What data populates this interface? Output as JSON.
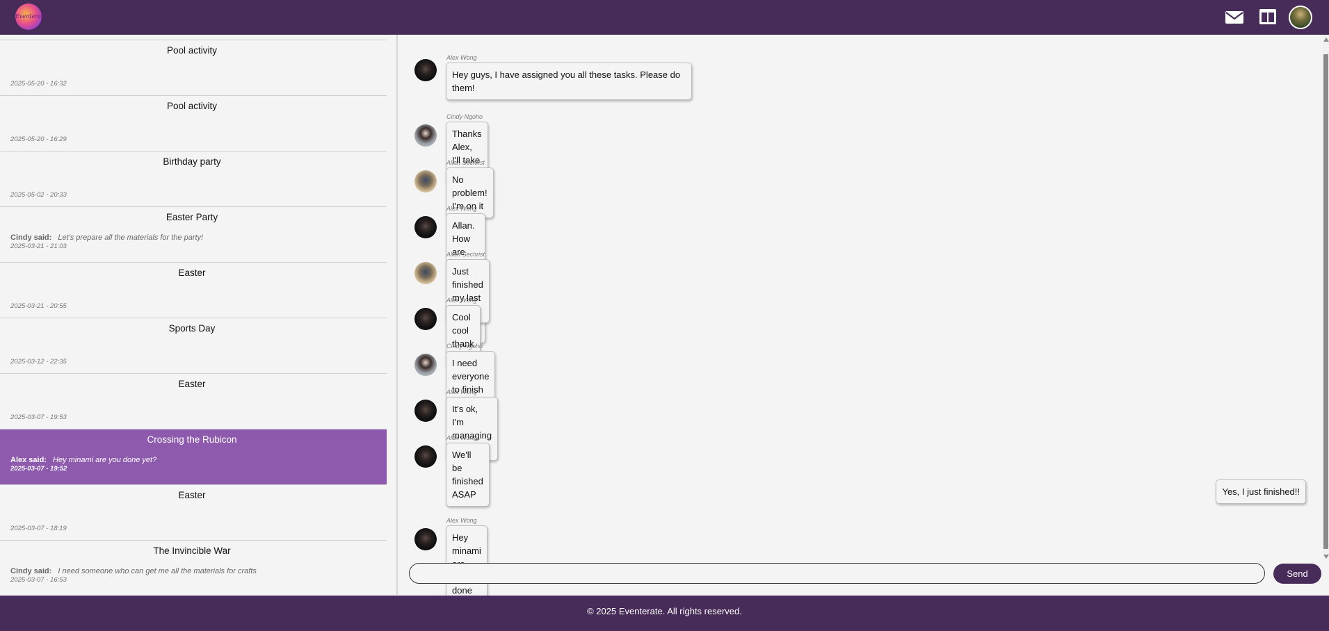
{
  "app": {
    "logo_text": "Eventerate",
    "icons": [
      "mail-icon",
      "layout-icon"
    ],
    "accent_color": "#472b58",
    "active_color": "#8e5aae"
  },
  "sidebar": {
    "chats": [
      {
        "title": "Pool activity",
        "sender": "",
        "message": "",
        "time": "2025-05-20 - 16:32"
      },
      {
        "title": "Pool activity",
        "sender": "",
        "message": "",
        "time": "2025-05-20 - 16:29"
      },
      {
        "title": "Birthday party",
        "sender": "",
        "message": "",
        "time": "2025-05-02 - 20:33"
      },
      {
        "title": "Easter Party",
        "sender": "Cindy said:",
        "message": "Let's prepare all the materials for the party!",
        "time": "2025-03-21 - 21:03"
      },
      {
        "title": "Easter",
        "sender": "",
        "message": "",
        "time": "2025-03-21 - 20:55"
      },
      {
        "title": "Sports Day",
        "sender": "",
        "message": "",
        "time": "2025-03-12 - 22:35"
      },
      {
        "title": "Easter",
        "sender": "",
        "message": "",
        "time": "2025-03-07 - 19:53"
      },
      {
        "title": "Crossing the Rubicon",
        "sender": "Alex said:",
        "message": "Hey minami are you done yet?",
        "time": "2025-03-07 - 19:52"
      },
      {
        "title": "Easter",
        "sender": "",
        "message": "",
        "time": "2025-03-07 - 18:19"
      },
      {
        "title": "The Invincible War",
        "sender": "Cindy said:",
        "message": "I need someone who can get me all the materials for crafts",
        "time": "2025-03-07 - 16:53"
      }
    ]
  },
  "conversation": {
    "messages": [
      {
        "sender": "Alex Wong",
        "text": "Hey guys, I have assigned you all these tasks. Please do them!"
      },
      {
        "sender": "Cindy Ngoho",
        "text": "Thanks Alex, I'll take a look."
      },
      {
        "sender": "Allan Sechrist",
        "text": "No problem! I'm on it"
      },
      {
        "sender": "Alex Wong",
        "text": "Allan. How are you getting on with the tasks?"
      },
      {
        "sender": "Allan Sechrist",
        "text": "Just finished my last task"
      },
      {
        "sender": "Alex Wong",
        "text": "Cool cool thank you!"
      },
      {
        "sender": "Cindy Ngoho",
        "text": "I need everyone to finish it as soon as possible!"
      },
      {
        "sender": "Alex Wong",
        "text": "It's ok, I'm managing it"
      },
      {
        "sender": "Alex Wong",
        "text": "We'll be finished ASAP"
      },
      {
        "sender": "",
        "text": "Yes, I just finished!!"
      },
      {
        "sender": "Alex Wong",
        "text": "Hey minami are you done yet?"
      }
    ]
  },
  "composer": {
    "input_value": "",
    "send_label": "Send"
  },
  "footer": {
    "text": "© 2025 Eventerate. All rights reserved."
  }
}
